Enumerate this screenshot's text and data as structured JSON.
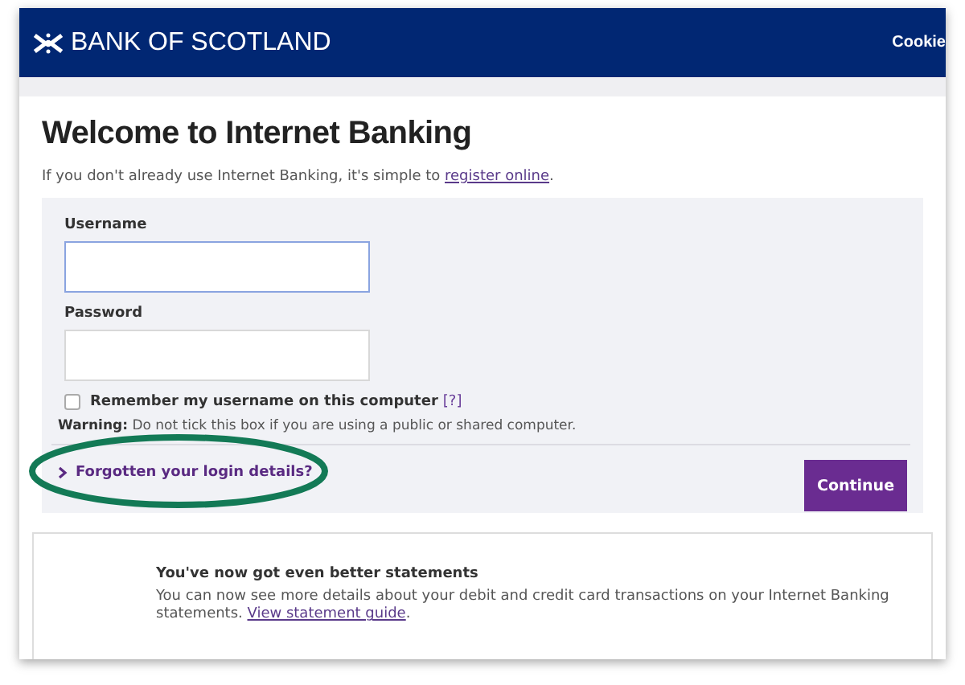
{
  "header": {
    "brand": "BANK OF SCOTLAND",
    "link": "Cookie"
  },
  "welcome": {
    "title": "Welcome to Internet Banking",
    "intro": "If you don't already use Internet Banking, it's simple to ",
    "intro_link": "register online",
    "intro_end": "."
  },
  "form": {
    "fields": [
      {
        "label": "Username",
        "focused": true
      },
      {
        "label": "Password",
        "focused": false
      }
    ],
    "remember": {
      "label": "Remember my username on this computer",
      "help": "[?]",
      "checked": false
    },
    "warning": "**Warning:** Do not tick this box if you are using a public or shared computer.",
    "forgotten": "Forgotten your login details?",
    "continue": "Continue"
  },
  "notice": {
    "title": "You've now got even better statements",
    "text": "You can now see more details about your debit and credit card transactions on your Internet Banking statements. ",
    "link": "View statement guide",
    "text_end": "."
  }
}
